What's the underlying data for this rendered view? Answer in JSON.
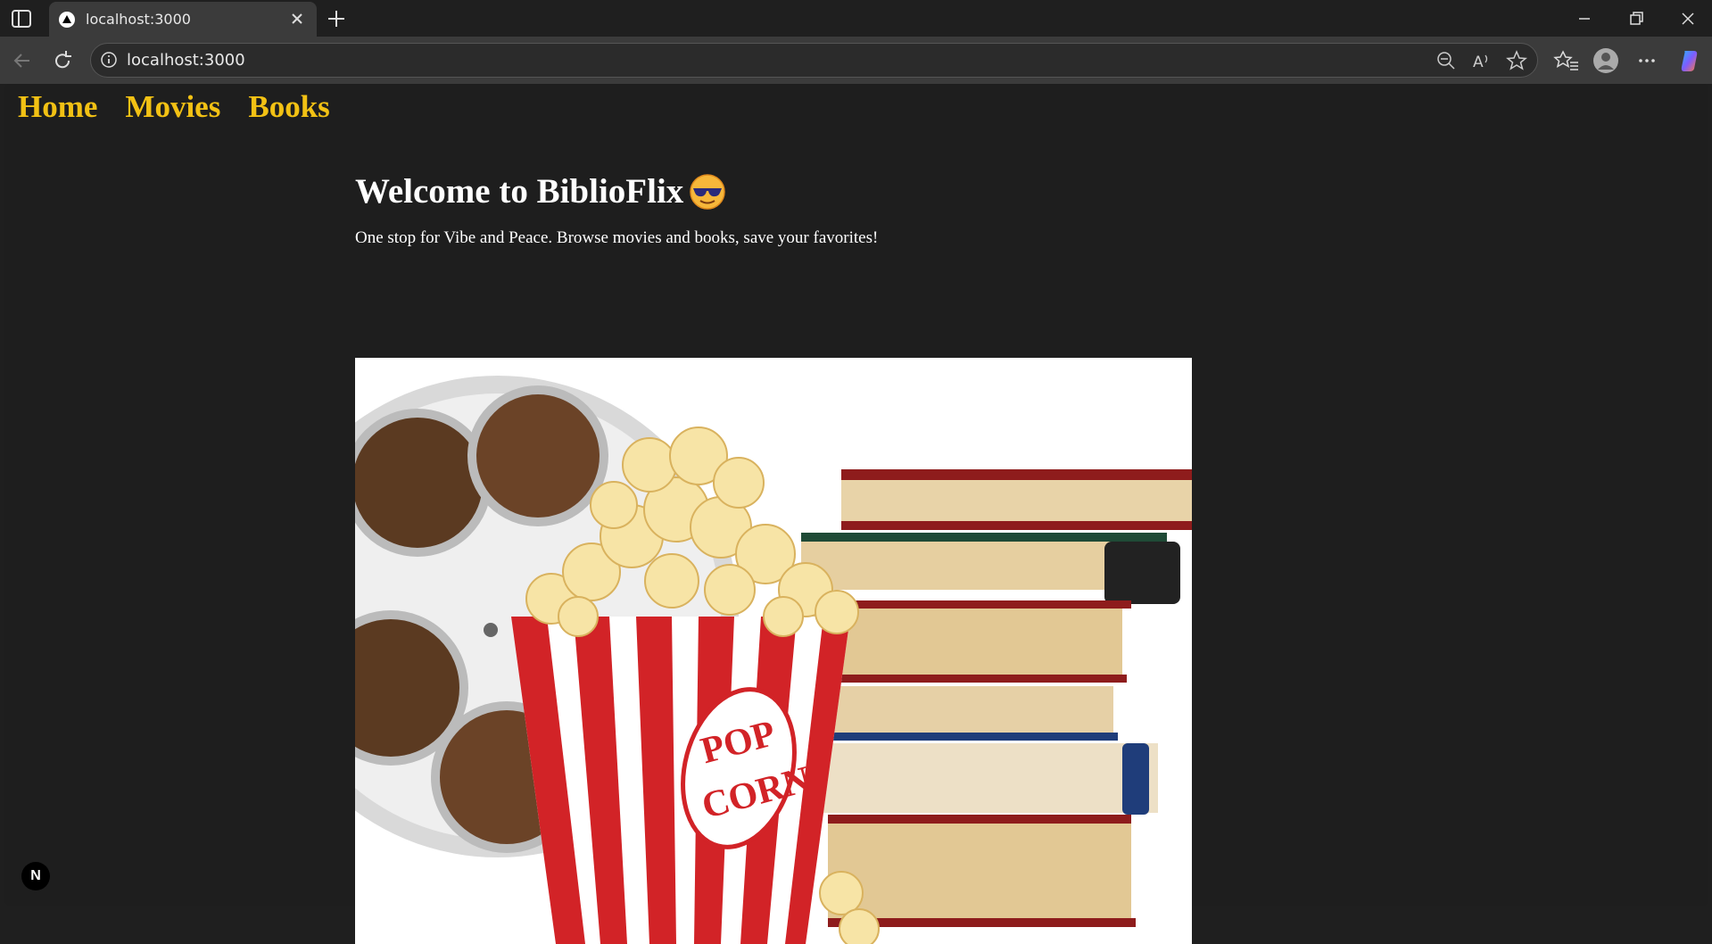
{
  "browser": {
    "tab_title": "localhost:3000",
    "url": "localhost:3000",
    "icons": [
      "sidebar-icon",
      "favicon",
      "close-icon",
      "plus-icon",
      "minimize-icon",
      "restore-icon",
      "close-window-icon",
      "back-icon",
      "reload-icon",
      "info-icon",
      "zoom-out-icon",
      "read-aloud-icon",
      "star-icon",
      "favorites-icon",
      "profile-icon",
      "more-icon",
      "copilot-icon"
    ]
  },
  "site_nav": {
    "home": "Home",
    "movies": "Movies",
    "books": "Books",
    "color": "#f2c114"
  },
  "hero": {
    "title": "Welcome to BiblioFlix",
    "emoji": "smiling-face-with-sunglasses",
    "subtitle": "One stop for Vibe and Peace. Browse movies and books, save your favorites!",
    "image_text": "POP CORN"
  },
  "dev_badge": "N"
}
